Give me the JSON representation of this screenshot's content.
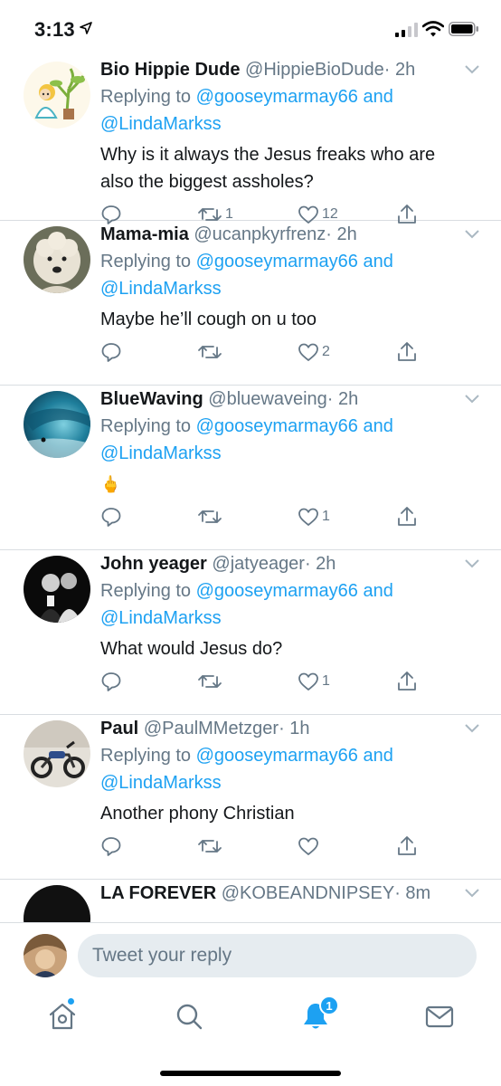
{
  "status_bar": {
    "time": "3:13"
  },
  "tweets": [
    {
      "name": "Bio Hippie Dude",
      "handle": "@HippieBioDude",
      "age": "· 2h",
      "replying_prefix": "Replying to",
      "replying_user1": "@gooseymarmay66",
      "replying_and": "and",
      "replying_user2": "@LindaMarkss",
      "text": "Why is it always the Jesus freaks who are also the biggest assholes?",
      "retweets": "1",
      "likes": "12"
    },
    {
      "name": "Mama-mia",
      "handle": "@ucanpkyrfrenz",
      "age": "· 2h",
      "replying_prefix": "Replying to",
      "replying_user1": "@gooseymarmay66",
      "replying_and": "and",
      "replying_user2": "@LindaMarkss",
      "text": "Maybe he’ll cough on u too",
      "retweets": "",
      "likes": "2"
    },
    {
      "name": "BlueWaving",
      "handle": "@bluewaveing",
      "age": "· 2h",
      "replying_prefix": "Replying to",
      "replying_user1": "@gooseymarmay66",
      "replying_and": "and",
      "replying_user2": "@LindaMarkss",
      "text": "🖕",
      "retweets": "",
      "likes": "1"
    },
    {
      "name": "John yeager",
      "handle": "@jatyeager",
      "age": "· 2h",
      "replying_prefix": "Replying to",
      "replying_user1": "@gooseymarmay66",
      "replying_and": "and",
      "replying_user2": "@LindaMarkss",
      "text": "What would Jesus do?",
      "retweets": "",
      "likes": "1"
    },
    {
      "name": "Paul",
      "handle": "@PaulMMetzger",
      "age": "· 1h",
      "replying_prefix": "Replying to",
      "replying_user1": "@gooseymarmay66",
      "replying_and": "and",
      "replying_user2": "@LindaMarkss",
      "text": "Another phony Christian",
      "retweets": "",
      "likes": ""
    },
    {
      "name": "LA FOREVER",
      "handle": "@KOBEANDNIPSEY",
      "age": "· 8m"
    }
  ],
  "reply_bar": {
    "placeholder": "Tweet your reply"
  },
  "tab_bar": {
    "notifications_badge": "1"
  },
  "colors": {
    "accent": "#1da1f2",
    "secondary_text": "#657786",
    "divider": "#d9dde1"
  },
  "icons": {
    "status": [
      "location-arrow-icon",
      "signal-icon",
      "wifi-icon",
      "battery-icon"
    ],
    "tweet_actions": [
      "reply-icon",
      "retweet-icon",
      "like-icon",
      "share-icon"
    ],
    "tabs": [
      "home-icon",
      "search-icon",
      "bell-icon",
      "mail-icon"
    ]
  }
}
